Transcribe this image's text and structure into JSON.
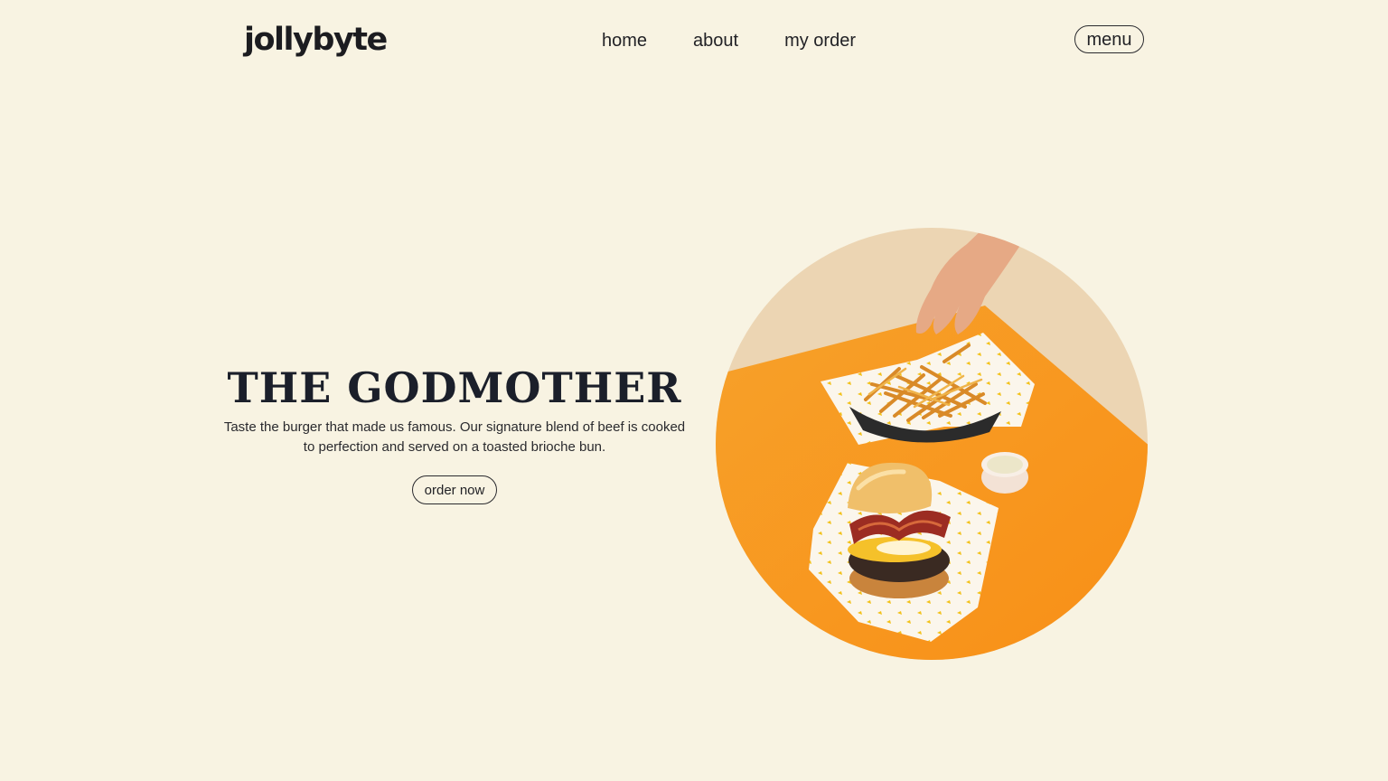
{
  "header": {
    "logo_text": "jollybyte",
    "nav": [
      {
        "label": "home"
      },
      {
        "label": "about"
      },
      {
        "label": "my order"
      }
    ],
    "menu_label": "menu"
  },
  "hero": {
    "title": "THE GODMOTHER",
    "description": "Taste the burger that made us famous. Our signature blend of beef is cooked to perfection and served on a toasted brioche bun.",
    "cta_label": "order now"
  },
  "colors": {
    "background": "#f8f3e2",
    "text": "#1b1f2a",
    "accent_orange": "#f7a12a"
  },
  "icons": {
    "hero_image": "burger-and-fries-photo"
  }
}
